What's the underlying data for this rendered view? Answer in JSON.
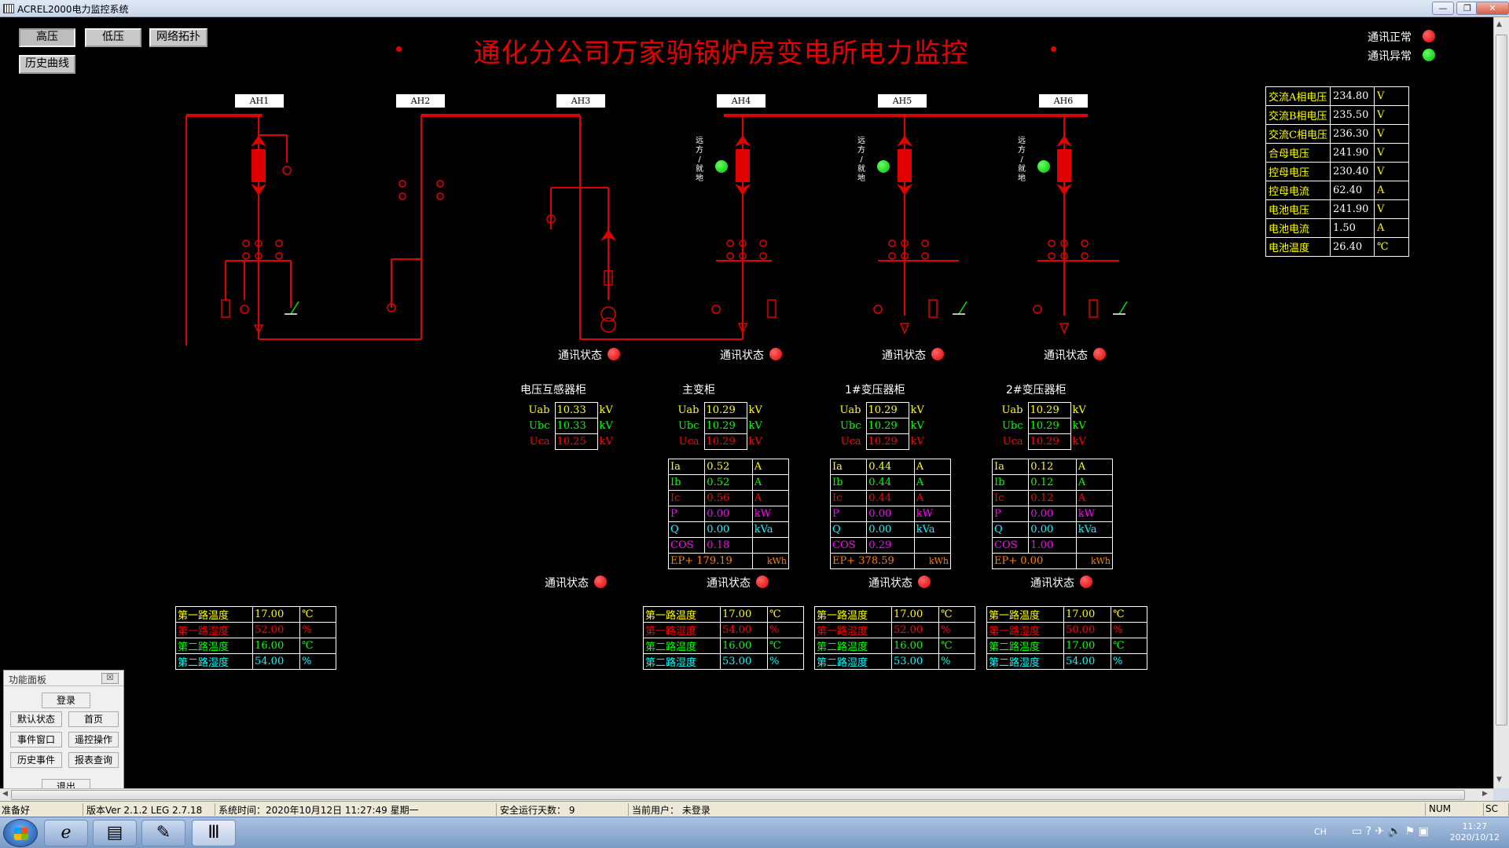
{
  "window": {
    "title": "ACREL2000电力监控系统"
  },
  "toolbar": {
    "high_voltage": "高压",
    "low_voltage": "低压",
    "network": "网络拓扑",
    "history_curve": "历史曲线"
  },
  "page_title": "通化分公司万家驹锅炉房变电所电力监控",
  "legend": {
    "comm_ok": "通讯正常",
    "comm_err": "通讯异常"
  },
  "colors": {
    "breaker": "#e00000",
    "ok": "#00c000",
    "alarm": "#e00000",
    "yellow": "#ffff00",
    "green": "#00ff00",
    "red": "#ff0000",
    "magenta": "#ff00ff",
    "cyan": "#00ffff",
    "orange": "#ff8000"
  },
  "cabinets_ah": [
    "AH1",
    "AH2",
    "AH3",
    "AH4",
    "AH5",
    "AH6"
  ],
  "remote_local": [
    "远",
    "方",
    "/",
    "就",
    "地"
  ],
  "comm_status_label": "通讯状态",
  "dc_panel": [
    {
      "name": "交流A相电压",
      "value": "234.80",
      "unit": "V"
    },
    {
      "name": "交流B相电压",
      "value": "235.50",
      "unit": "V"
    },
    {
      "name": "交流C相电压",
      "value": "236.30",
      "unit": "V"
    },
    {
      "name": "合母电压",
      "value": "241.90",
      "unit": "V"
    },
    {
      "name": "控母电压",
      "value": "230.40",
      "unit": "V"
    },
    {
      "name": "控母电流",
      "value": "62.40",
      "unit": "A"
    },
    {
      "name": "电池电压",
      "value": "241.90",
      "unit": "V"
    },
    {
      "name": "电池电流",
      "value": "1.50",
      "unit": "A"
    },
    {
      "name": "电池温度",
      "value": "26.40",
      "unit": "℃"
    }
  ],
  "meters": [
    {
      "title": "电压互感器柜",
      "voltages": [
        {
          "n": "Uab",
          "v": "10.33",
          "u": "kV"
        },
        {
          "n": "Ubc",
          "v": "10.33",
          "u": "kV"
        },
        {
          "n": "Uca",
          "v": "10.25",
          "u": "kV"
        }
      ]
    },
    {
      "title": "主变柜",
      "voltages": [
        {
          "n": "Uab",
          "v": "10.29",
          "u": "kV"
        },
        {
          "n": "Ubc",
          "v": "10.29",
          "u": "kV"
        },
        {
          "n": "Uca",
          "v": "10.29",
          "u": "kV"
        }
      ],
      "power": [
        {
          "n": "Ia",
          "v": "0.52",
          "u": "A"
        },
        {
          "n": "Ib",
          "v": "0.52",
          "u": "A"
        },
        {
          "n": "Ic",
          "v": "0.56",
          "u": "A"
        },
        {
          "n": "P",
          "v": "0.00",
          "u": "kW"
        },
        {
          "n": "Q",
          "v": "0.00",
          "u": "kVa"
        },
        {
          "n": "COS",
          "v": "0.18",
          "u": ""
        }
      ],
      "ep": {
        "n": "EP+",
        "v": "179.19",
        "u": "kWh"
      }
    },
    {
      "title": "1#变压器柜",
      "voltages": [
        {
          "n": "Uab",
          "v": "10.29",
          "u": "kV"
        },
        {
          "n": "Ubc",
          "v": "10.29",
          "u": "kV"
        },
        {
          "n": "Uca",
          "v": "10.29",
          "u": "kV"
        }
      ],
      "power": [
        {
          "n": "Ia",
          "v": "0.44",
          "u": "A"
        },
        {
          "n": "Ib",
          "v": "0.44",
          "u": "A"
        },
        {
          "n": "Ic",
          "v": "0.44",
          "u": "A"
        },
        {
          "n": "P",
          "v": "0.00",
          "u": "kW"
        },
        {
          "n": "Q",
          "v": "0.00",
          "u": "kVa"
        },
        {
          "n": "COS",
          "v": "0.29",
          "u": ""
        }
      ],
      "ep": {
        "n": "EP+",
        "v": "378.59",
        "u": "kWh"
      }
    },
    {
      "title": "2#变压器柜",
      "voltages": [
        {
          "n": "Uab",
          "v": "10.29",
          "u": "kV"
        },
        {
          "n": "Ubc",
          "v": "10.29",
          "u": "kV"
        },
        {
          "n": "Uca",
          "v": "10.29",
          "u": "kV"
        }
      ],
      "power": [
        {
          "n": "Ia",
          "v": "0.12",
          "u": "A"
        },
        {
          "n": "Ib",
          "v": "0.12",
          "u": "A"
        },
        {
          "n": "Ic",
          "v": "0.12",
          "u": "A"
        },
        {
          "n": "P",
          "v": "0.00",
          "u": "kW"
        },
        {
          "n": "Q",
          "v": "0.00",
          "u": "kVa"
        },
        {
          "n": "COS",
          "v": "1.00",
          "u": ""
        }
      ],
      "ep": {
        "n": "EP+",
        "v": "0.00",
        "u": "kWh"
      }
    }
  ],
  "temp_tables": [
    [
      {
        "n": "第一路温度",
        "v": "17.00",
        "u": "℃"
      },
      {
        "n": "第一路湿度",
        "v": "52.00",
        "u": "%"
      },
      {
        "n": "第二路温度",
        "v": "16.00",
        "u": "℃"
      },
      {
        "n": "第二路湿度",
        "v": "54.00",
        "u": "%"
      }
    ],
    [
      {
        "n": "第一路温度",
        "v": "17.00",
        "u": "℃"
      },
      {
        "n": "第一路湿度",
        "v": "54.00",
        "u": "%"
      },
      {
        "n": "第二路温度",
        "v": "16.00",
        "u": "℃"
      },
      {
        "n": "第二路湿度",
        "v": "53.00",
        "u": "%"
      }
    ],
    [
      {
        "n": "第一路温度",
        "v": "17.00",
        "u": "℃"
      },
      {
        "n": "第一路湿度",
        "v": "52.00",
        "u": "%"
      },
      {
        "n": "第二路温度",
        "v": "16.00",
        "u": "℃"
      },
      {
        "n": "第二路湿度",
        "v": "53.00",
        "u": "%"
      }
    ],
    [
      {
        "n": "第一路温度",
        "v": "17.00",
        "u": "℃"
      },
      {
        "n": "第一路湿度",
        "v": "50.00",
        "u": "%"
      },
      {
        "n": "第二路温度",
        "v": "17.00",
        "u": "℃"
      },
      {
        "n": "第二路湿度",
        "v": "54.00",
        "u": "%"
      }
    ]
  ],
  "function_panel": {
    "title": "功能面板",
    "close": "☒",
    "login": "登录",
    "default_state": "默认状态",
    "home": "首页",
    "event_window": "事件窗口",
    "remote_control": "遥控操作",
    "history_event": "历史事件",
    "report_query": "报表查询",
    "exit": "退出"
  },
  "statusbar": {
    "ready": "准备好",
    "version": "版本Ver 2.1.2 LEG 2.7.18",
    "systime": "系统时间：2020年10月12日   11:27:49    星期一",
    "safe_days": "安全运行天数：  9",
    "current_user": "当前用户：  未登录",
    "num": "NUM",
    "scroll": "SC"
  },
  "taskbar": {
    "lang": "CH",
    "time": "11:27",
    "date": "2020/10/12"
  }
}
